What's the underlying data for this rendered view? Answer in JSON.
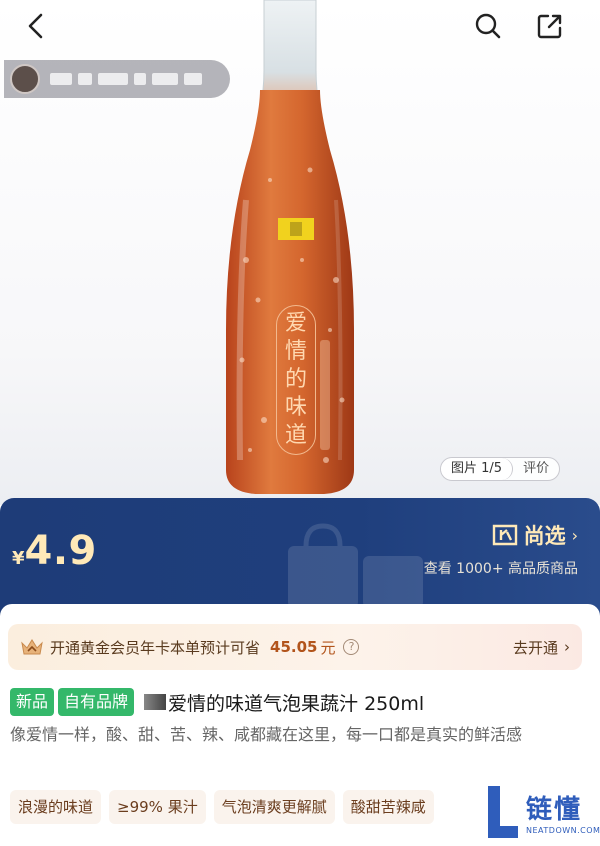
{
  "nav": {
    "back_icon": "chevron-left-icon",
    "search_icon": "search-icon",
    "share_icon": "share-icon"
  },
  "shop": {
    "name_blurred": true
  },
  "product_image": {
    "label_chars": [
      "爱",
      "情",
      "的",
      "味",
      "道"
    ],
    "counter": "图片 1/5",
    "reviews_tab": "评价"
  },
  "price_banner": {
    "currency": "¥",
    "price": "4.9",
    "brand": "尚选",
    "brand_chevron": "›",
    "subtitle": "查看 1000+ 高品质商品"
  },
  "membership": {
    "text": "开通黄金会员年卡本单预计可省",
    "amount": "45.05",
    "unit": "元",
    "help": "?",
    "action": "去开通",
    "action_chevron": "›"
  },
  "product": {
    "tags": [
      "新品",
      "自有品牌"
    ],
    "title": "爱情的味道气泡果蔬汁 250ml",
    "description": "像爱情一样，酸、甜、苦、辣、咸都藏在这里，每一口都是真实的鲜活感",
    "features": [
      "浪漫的味道",
      "≥99% 果汁",
      "气泡清爽更解腻",
      "酸甜苦辣咸"
    ]
  },
  "watermark": {
    "cn": "链懂",
    "en": "NEATDOWN.COM"
  },
  "colors": {
    "banner": "#1e3c78",
    "price": "#ffe9b8",
    "tag_green": "#34b86a",
    "savings": "#b2541b"
  }
}
